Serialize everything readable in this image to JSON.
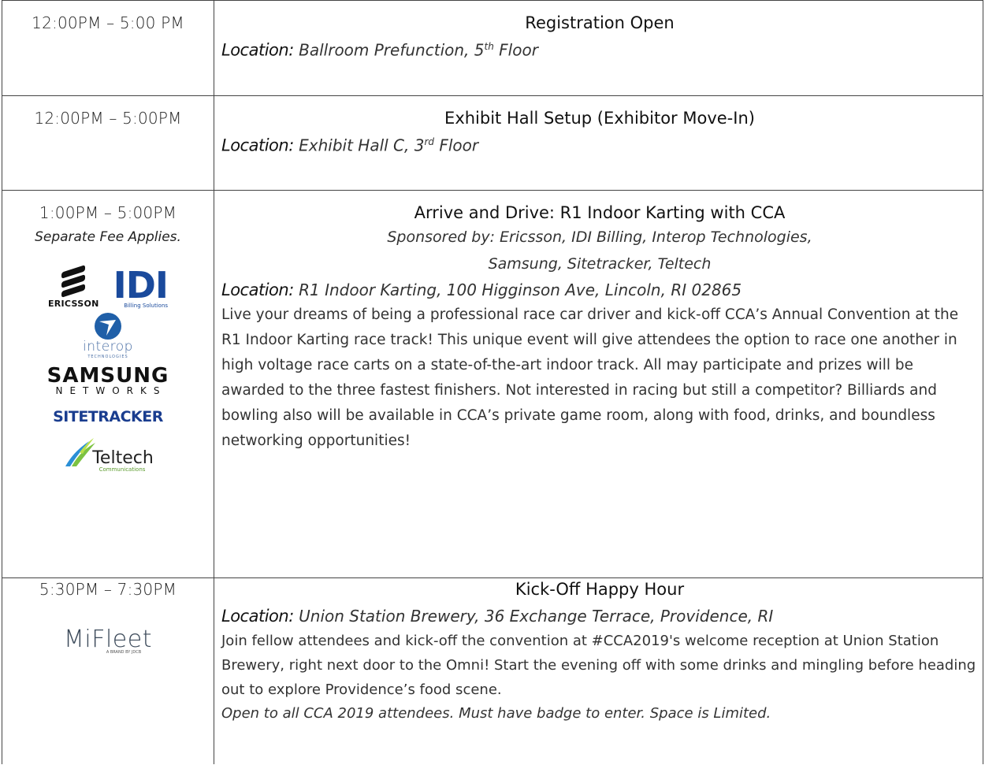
{
  "rows": [
    {
      "time": "12:00PM – 5:00 PM",
      "title": "Registration Open",
      "location_label": "Location:",
      "location_text": "Ballroom Prefunction, 5",
      "location_sup": "th",
      "location_tail": "Floor"
    },
    {
      "time": "12:00PM – 5:00PM",
      "title": "Exhibit Hall Setup (Exhibitor Move-In)",
      "location_label": "Location:",
      "location_text": "Exhibit Hall C, 3",
      "location_sup": "rd",
      "location_tail": "Floor"
    },
    {
      "time": "1:00PM – 5:00PM",
      "fee": "Separate Fee Applies.",
      "title": "Arrive and Drive: R1 Indoor Karting with CCA",
      "sponsored_line1": "Sponsored by: Ericsson, IDI Billing, Interop Technologies,",
      "sponsored_line2": "Samsung, Sitetracker, Teltech",
      "location_label": "Location:",
      "location_text": "R1 Indoor Karting, 100 Higginson Ave, Lincoln, RI 02865",
      "description": "Live your dreams of being a professional race car driver and kick-off CCA’s Annual Convention at the R1 Indoor Karting race track! This unique event will give attendees the option to race one another in high voltage race carts on a state-of-the-art indoor track. All may participate and prizes will be awarded to the three fastest finishers. Not interested in racing but still a competitor? Billiards and bowling also will be available in CCA’s private game room, along with food, drinks, and boundless networking opportunities!",
      "logos": {
        "ericsson": "ERICSSON",
        "idi": "IDI",
        "idi_tag": "Billing Solutions",
        "interop": "interop",
        "interop_tag": "TECHNOLOGIES",
        "samsung": "SAMSUNG",
        "samsung_tag": "NETWORKS",
        "sitetracker": "SITETRACKER",
        "teltech": "Teltech",
        "teltech_tag": "Communications"
      }
    },
    {
      "time": "5:30PM – 7:30PM",
      "title": "Kick-Off Happy Hour",
      "location_label": "Location:",
      "location_text": "Union Station Brewery, 36 Exchange Terrace, Providence, RI",
      "description": "Join fellow attendees and kick-off the convention at #CCA2019's welcome reception at Union Station Brewery, right next door to the Omni! Start the evening off with some drinks and mingling before heading out to explore Providence’s food scene.",
      "note": "Open to all CCA 2019 attendees. Must have badge to enter. Space is Limited.",
      "logos": {
        "mifleet": "MiFleet",
        "mifleet_tag": "A BRAND BY JDCB"
      }
    }
  ],
  "colors": {
    "idi_blue": "#1a4a9c",
    "interop_blue": "#4a6fa5",
    "sitetracker_blue": "#1a3d8f",
    "teltech_green": "#5a9a2b"
  }
}
